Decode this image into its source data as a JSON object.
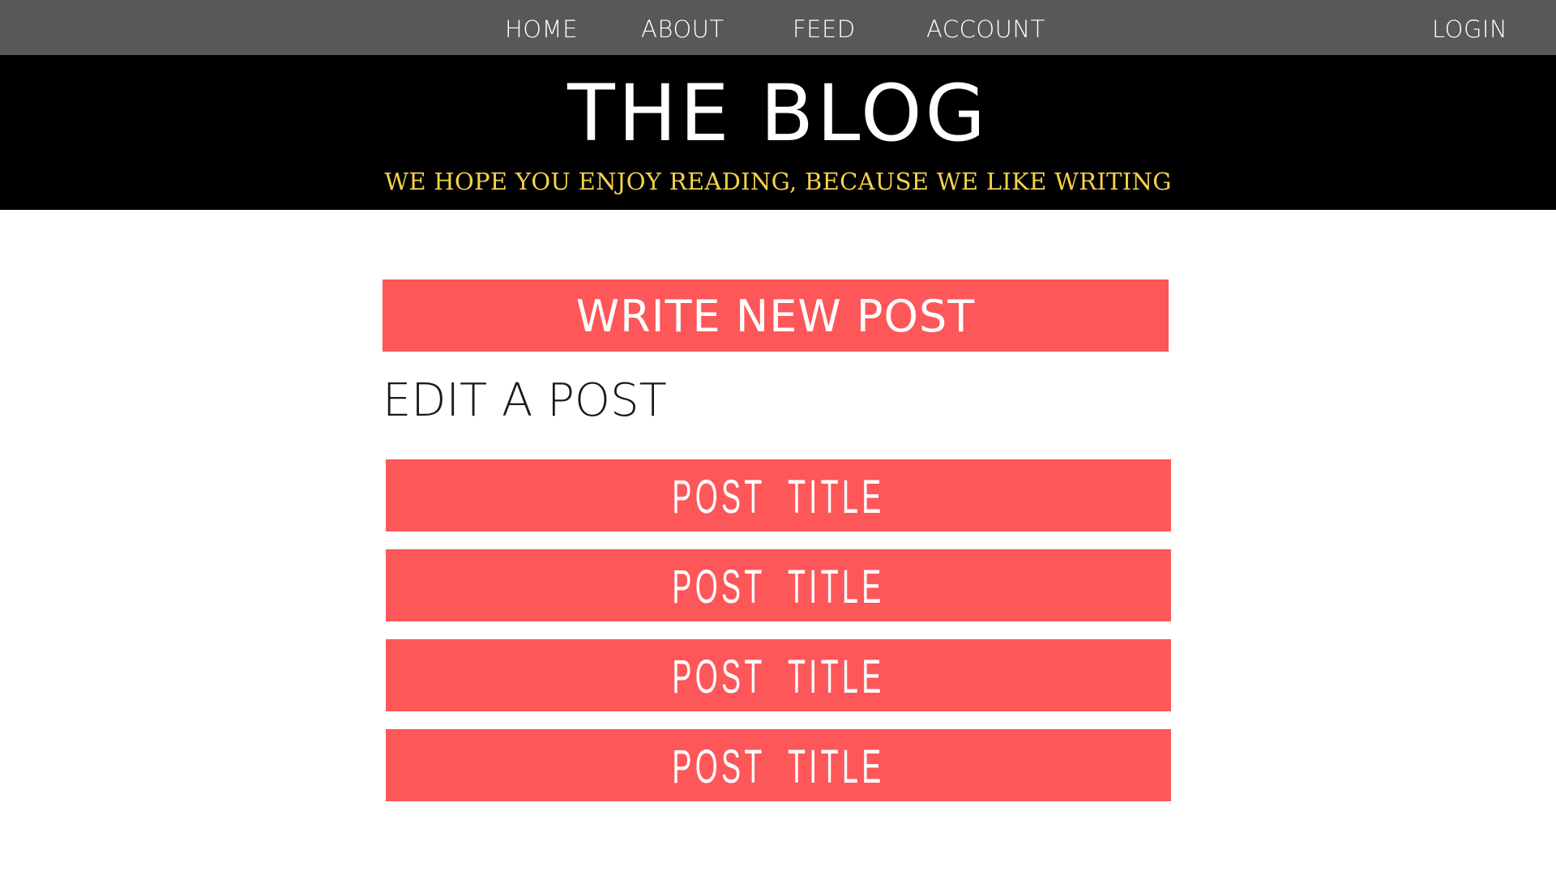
{
  "nav": {
    "items": [
      {
        "label": "HOME"
      },
      {
        "label": "ABOUT"
      },
      {
        "label": "FEED"
      },
      {
        "label": "ACCOUNT"
      }
    ],
    "login_label": "LOGIN"
  },
  "header": {
    "title": "THE BLOG",
    "tagline": "WE HOPE YOU ENJOY READING, BECAUSE WE LIKE WRITING"
  },
  "main": {
    "write_button_label": "WRITE NEW POST",
    "edit_heading": "EDIT A POST",
    "posts": [
      {
        "title": "POST  TITLE"
      },
      {
        "title": "POST  TITLE"
      },
      {
        "title": "POST  TITLE"
      },
      {
        "title": "POST  TITLE"
      }
    ]
  },
  "colors": {
    "nav_background": "#585858",
    "header_background": "#000000",
    "tagline": "#f6d24a",
    "accent": "#fd5759",
    "text_on_accent": "#ffffff"
  }
}
